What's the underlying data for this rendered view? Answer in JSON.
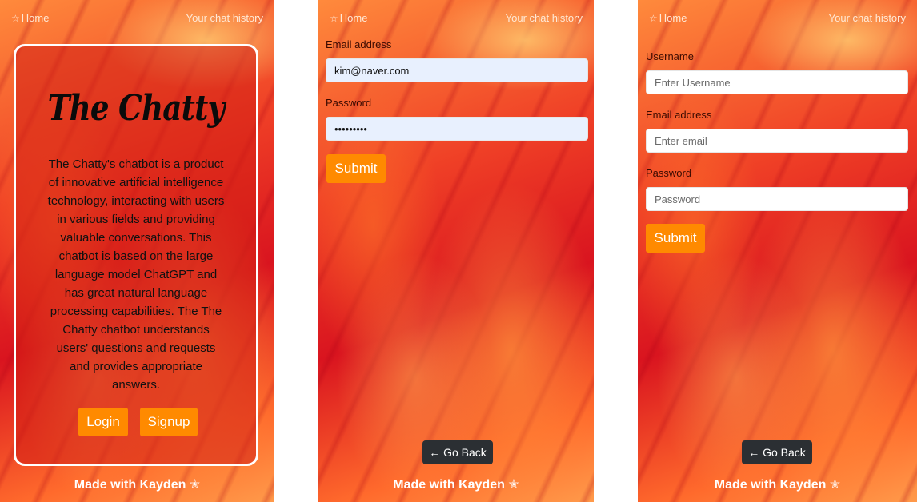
{
  "colors": {
    "accent": "#ff8a00",
    "dark_button": "#2b2f33",
    "card_border": "#ffffff"
  },
  "nav": {
    "home_icon": "star-outline-icon",
    "home_label": "Home",
    "history_label": "Your chat history"
  },
  "footer": {
    "text": "Made with Kayden ✭"
  },
  "landing": {
    "logo": "The Chatty",
    "description": "The Chatty's chatbot is a product of innovative artificial intelligence technology, interacting with users in various fields and providing valuable conversations. This chatbot is based on the large language model ChatGPT and has great natural language processing capabilities. The The Chatty chatbot understands users' questions and requests and provides appropriate answers.",
    "login_label": "Login",
    "signup_label": "Signup"
  },
  "login": {
    "email_label": "Email address",
    "email_value": "kim@naver.com",
    "password_label": "Password",
    "password_value": "•••••••••",
    "submit_label": "Submit",
    "back_label": "← Go Back"
  },
  "signup": {
    "username_label": "Username",
    "username_placeholder": "Enter Username",
    "email_label": "Email address",
    "email_placeholder": "Enter email",
    "password_label": "Password",
    "password_placeholder": "Password",
    "submit_label": "Submit",
    "back_label": "← Go Back"
  }
}
